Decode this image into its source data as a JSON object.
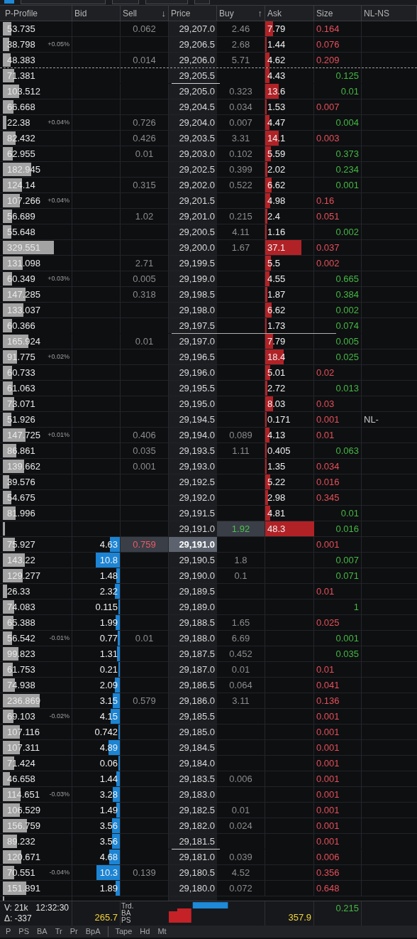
{
  "toolbar": {
    "fields": [
      {
        "kind": "checkbox",
        "checked": true
      },
      {
        "kind": "field"
      },
      {
        "kind": "field"
      },
      {
        "kind": "field"
      },
      {
        "kind": "field"
      }
    ]
  },
  "columns": [
    "P-Profile",
    "Bid",
    "Sell",
    "Price",
    "Buy",
    "Ask",
    "Size",
    "NL-NS"
  ],
  "sort": {
    "sell": "↓",
    "buy": "↑"
  },
  "rows": [
    {
      "profile": {
        "text": "53.735",
        "level": 0.12
      },
      "sell": "0.062",
      "price": "29,207.0",
      "buy": "2.46",
      "ask": {
        "text": "7.79",
        "level": 0.16
      },
      "lot": {
        "text": "0.164",
        "kind": "sell"
      }
    },
    {
      "profile": {
        "text": "38.798",
        "level": 0.09
      },
      "change": "+0.05%",
      "price": "29,206.5",
      "buy": "2.68",
      "ask": {
        "text": "1.44",
        "level": 0.03
      },
      "lot": {
        "text": "0.076",
        "kind": "sell"
      }
    },
    {
      "profile": {
        "text": "48.383",
        "level": 0.11
      },
      "sell": "0.014",
      "price": "29,206.0",
      "buy": "5.71",
      "ask": {
        "text": "4.62",
        "level": 0.09
      },
      "lot": {
        "text": "0.209",
        "kind": "sell"
      },
      "divider": {
        "kind": "dashed"
      }
    },
    {
      "profile": {
        "text": "71.381",
        "level": 0.16
      },
      "price": "29,205.5",
      "ask": {
        "text": "4.43",
        "level": 0.09
      },
      "lot": {
        "text": "0.125",
        "kind": "buy"
      },
      "divider": {
        "kind": "price"
      }
    },
    {
      "profile": {
        "text": "103.512",
        "level": 0.23
      },
      "price": "29,205.0",
      "buy": "0.323",
      "ask": {
        "text": "13.6",
        "level": 0.27
      },
      "lot": {
        "text": "0.01",
        "kind": "buy"
      }
    },
    {
      "profile": {
        "text": "66.668",
        "level": 0.15
      },
      "price": "29,204.5",
      "buy": "0.034",
      "ask": {
        "text": "1.53",
        "level": 0.03
      },
      "lot": {
        "text": "0.007",
        "kind": "sell"
      }
    },
    {
      "profile": {
        "text": "22.38",
        "level": 0.05
      },
      "change": "+0.04%",
      "sell": "0.726",
      "price": "29,204.0",
      "buy": "0.007",
      "ask": {
        "text": "4.47",
        "level": 0.09
      },
      "lot": {
        "text": "0.004",
        "kind": "buy"
      }
    },
    {
      "profile": {
        "text": "82.432",
        "level": 0.18
      },
      "sell": "0.426",
      "price": "29,203.5",
      "buy": "3.31",
      "ask": {
        "text": "14.1",
        "level": 0.28
      },
      "lot": {
        "text": "0.003",
        "kind": "sell"
      }
    },
    {
      "profile": {
        "text": "62.955",
        "level": 0.14
      },
      "sell": "0.01",
      "price": "29,203.0",
      "buy": "0.102",
      "ask": {
        "text": "5.59",
        "level": 0.11
      },
      "lot": {
        "text": "0.373",
        "kind": "buy"
      }
    },
    {
      "profile": {
        "text": "182.945",
        "level": 0.41
      },
      "price": "29,202.5",
      "buy": "0.399",
      "ask": {
        "text": "2.02",
        "level": 0.04
      },
      "lot": {
        "text": "0.234",
        "kind": "buy"
      }
    },
    {
      "profile": {
        "text": "124.14",
        "level": 0.28
      },
      "sell": "0.315",
      "price": "29,202.0",
      "buy": "0.522",
      "ask": {
        "text": "6.62",
        "level": 0.13
      },
      "lot": {
        "text": "0.001",
        "kind": "buy"
      }
    },
    {
      "profile": {
        "text": "107.266",
        "level": 0.24
      },
      "change": "+0.04%",
      "price": "29,201.5",
      "ask": {
        "text": "4.98",
        "level": 0.1
      },
      "lot": {
        "text": "0.16",
        "kind": "sell"
      }
    },
    {
      "profile": {
        "text": "56.689",
        "level": 0.13
      },
      "sell": "1.02",
      "price": "29,201.0",
      "buy": "0.215",
      "ask": {
        "text": "2.4",
        "level": 0.05
      },
      "lot": {
        "text": "0.051",
        "kind": "sell"
      }
    },
    {
      "profile": {
        "text": "55.648",
        "level": 0.12
      },
      "price": "29,200.5",
      "buy": "4.11",
      "ask": {
        "text": "1.16",
        "level": 0.02
      },
      "lot": {
        "text": "0.002",
        "kind": "buy"
      }
    },
    {
      "profile": {
        "text": "329.551",
        "level": 0.73
      },
      "price": "29,200.0",
      "buy": "1.67",
      "ask": {
        "text": "37.1",
        "level": 0.74
      },
      "lot": {
        "text": "0.037",
        "kind": "sell"
      }
    },
    {
      "profile": {
        "text": "131.098",
        "level": 0.29
      },
      "sell": "2.71",
      "price": "29,199.5",
      "ask": {
        "text": "5.5",
        "level": 0.11
      },
      "lot": {
        "text": "0.002",
        "kind": "sell"
      }
    },
    {
      "profile": {
        "text": "60.349",
        "level": 0.13
      },
      "change": "+0.03%",
      "sell": "0.005",
      "price": "29,199.0",
      "ask": {
        "text": "4.55",
        "level": 0.09
      },
      "lot": {
        "text": "0.665",
        "kind": "buy"
      }
    },
    {
      "profile": {
        "text": "147.285",
        "level": 0.33
      },
      "sell": "0.318",
      "price": "29,198.5",
      "ask": {
        "text": "1.87",
        "level": 0.04
      },
      "lot": {
        "text": "0.384",
        "kind": "buy"
      }
    },
    {
      "profile": {
        "text": "133.037",
        "level": 0.3
      },
      "price": "29,198.0",
      "ask": {
        "text": "6.62",
        "level": 0.13
      },
      "lot": {
        "text": "0.002",
        "kind": "buy"
      }
    },
    {
      "profile": {
        "text": "60.366",
        "level": 0.13
      },
      "price": "29,197.5",
      "ask": {
        "text": "1.73",
        "level": 0.03
      },
      "lot": {
        "text": "0.074",
        "kind": "buy"
      },
      "divider": {
        "kind": "wide"
      }
    },
    {
      "profile": {
        "text": "165.924",
        "level": 0.37
      },
      "sell": "0.01",
      "price": "29,197.0",
      "ask": {
        "text": "7.79",
        "level": 0.16
      },
      "lot": {
        "text": "0.005",
        "kind": "buy"
      }
    },
    {
      "profile": {
        "text": "91.775",
        "level": 0.2
      },
      "change": "+0.02%",
      "price": "29,196.5",
      "ask": {
        "text": "18.4",
        "level": 0.37
      },
      "lot": {
        "text": "0.025",
        "kind": "buy"
      }
    },
    {
      "profile": {
        "text": "60.733",
        "level": 0.13
      },
      "price": "29,196.0",
      "ask": {
        "text": "5.01",
        "level": 0.1
      },
      "lot": {
        "text": "0.02",
        "kind": "sell"
      }
    },
    {
      "profile": {
        "text": "61.063",
        "level": 0.14
      },
      "price": "29,195.5",
      "ask": {
        "text": "2.72",
        "level": 0.05
      },
      "lot": {
        "text": "0.013",
        "kind": "buy"
      }
    },
    {
      "profile": {
        "text": "73.071",
        "level": 0.16
      },
      "price": "29,195.0",
      "ask": {
        "text": "8.03",
        "level": 0.16
      },
      "lot": {
        "text": "0.03",
        "kind": "sell"
      }
    },
    {
      "profile": {
        "text": "51.926",
        "level": 0.12
      },
      "price": "29,194.5",
      "ask": {
        "text": "0.171",
        "level": 0.01
      },
      "lot": {
        "text": "0.001",
        "kind": "sell"
      },
      "nl_ns": "NL-"
    },
    {
      "profile": {
        "text": "147.725",
        "level": 0.33
      },
      "change": "+0.01%",
      "sell": "0.406",
      "price": "29,194.0",
      "buy": "0.089",
      "ask": {
        "text": "4.13",
        "level": 0.08
      },
      "lot": {
        "text": "0.01",
        "kind": "sell"
      }
    },
    {
      "profile": {
        "text": "86.861",
        "level": 0.19
      },
      "sell": "0.035",
      "price": "29,193.5",
      "buy": "1.11",
      "ask": {
        "text": "0.405",
        "level": 0.01
      },
      "lot": {
        "text": "0.063",
        "kind": "buy"
      }
    },
    {
      "profile": {
        "text": "139.662",
        "level": 0.31
      },
      "sell": "0.001",
      "price": "29,193.0",
      "ask": {
        "text": "1.35",
        "level": 0.03
      },
      "lot": {
        "text": "0.034",
        "kind": "sell"
      }
    },
    {
      "profile": {
        "text": "39.576",
        "level": 0.09
      },
      "price": "29,192.5",
      "ask": {
        "text": "5.22",
        "level": 0.1
      },
      "lot": {
        "text": "0.016",
        "kind": "sell"
      }
    },
    {
      "profile": {
        "text": "54.675",
        "level": 0.12
      },
      "price": "29,192.0",
      "ask": {
        "text": "2.98",
        "level": 0.06
      },
      "lot": {
        "text": "0.345",
        "kind": "sell"
      }
    },
    {
      "profile": {
        "text": "81.996",
        "level": 0.18
      },
      "price": "29,191.5",
      "ask": {
        "text": "4.81",
        "level": 0.1
      },
      "lot": {
        "text": "0.01",
        "kind": "buy"
      }
    },
    {
      "profile": {
        "level": 0.02
      },
      "price": "29,191.0",
      "buy": "1.92",
      "ask": {
        "text": "48.3",
        "level": 1
      },
      "lot": {
        "text": "0.016",
        "kind": "buy"
      },
      "highlight": {
        "kind": "buy"
      }
    },
    {
      "profile": {
        "text": "75.927",
        "level": 0.17
      },
      "bid": {
        "text": "4.63",
        "level": 0.21
      },
      "sell": "0.759",
      "price": "29,191.0",
      "lot": {
        "text": "0.001",
        "kind": "sell"
      },
      "highlight": {
        "kind": "trade"
      }
    },
    {
      "profile": {
        "text": "143.22",
        "level": 0.32
      },
      "bid": {
        "text": "10.8",
        "level": 0.5
      },
      "price": "29,190.5",
      "buy": "1.8",
      "lot": {
        "text": "0.007",
        "kind": "buy"
      }
    },
    {
      "profile": {
        "text": "129.277",
        "level": 0.29
      },
      "bid": {
        "text": "1.48",
        "level": 0.07
      },
      "price": "29,190.0",
      "buy": "0.1",
      "lot": {
        "text": "0.071",
        "kind": "buy"
      }
    },
    {
      "profile": {
        "text": "26.33",
        "level": 0.06
      },
      "bid": {
        "text": "2.32",
        "level": 0.11
      },
      "price": "29,189.5",
      "lot": {
        "text": "0.01",
        "kind": "sell"
      }
    },
    {
      "profile": {
        "text": "74.083",
        "level": 0.16
      },
      "bid": {
        "text": "0.115",
        "level": 0.01
      },
      "price": "29,189.0",
      "lot": {
        "text": "1",
        "kind": "buy"
      }
    },
    {
      "profile": {
        "text": "65.388",
        "level": 0.15
      },
      "bid": {
        "text": "1.99",
        "level": 0.09
      },
      "price": "29,188.5",
      "buy": "1.65",
      "lot": {
        "text": "0.025",
        "kind": "sell"
      }
    },
    {
      "profile": {
        "text": "56.542",
        "level": 0.13
      },
      "change": "-0.01%",
      "bid": {
        "text": "0.77",
        "level": 0.04
      },
      "sell": "0.01",
      "price": "29,188.0",
      "buy": "6.69",
      "lot": {
        "text": "0.001",
        "kind": "buy"
      }
    },
    {
      "profile": {
        "text": "99.823",
        "level": 0.22
      },
      "bid": {
        "text": "1.31",
        "level": 0.06
      },
      "price": "29,187.5",
      "buy": "0.452",
      "lot": {
        "text": "0.035",
        "kind": "buy"
      }
    },
    {
      "profile": {
        "text": "61.753",
        "level": 0.14
      },
      "bid": {
        "text": "0.21",
        "level": 0.01
      },
      "price": "29,187.0",
      "buy": "0.01",
      "lot": {
        "text": "0.01",
        "kind": "sell"
      }
    },
    {
      "profile": {
        "text": "74.938",
        "level": 0.17
      },
      "bid": {
        "text": "2.09",
        "level": 0.1
      },
      "price": "29,186.5",
      "buy": "0.064",
      "lot": {
        "text": "0.041",
        "kind": "sell"
      }
    },
    {
      "profile": {
        "text": "236.869",
        "level": 0.53
      },
      "bid": {
        "text": "3.15",
        "level": 0.15
      },
      "sell": "0.579",
      "price": "29,186.0",
      "buy": "3.11",
      "lot": {
        "text": "0.136",
        "kind": "sell"
      }
    },
    {
      "profile": {
        "text": "69.103",
        "level": 0.15
      },
      "change": "-0.02%",
      "bid": {
        "text": "4.15",
        "level": 0.19
      },
      "price": "29,185.5",
      "lot": {
        "text": "0.001",
        "kind": "sell"
      }
    },
    {
      "profile": {
        "text": "107.116",
        "level": 0.24
      },
      "bid": {
        "text": "0.742",
        "level": 0.03
      },
      "price": "29,185.0",
      "lot": {
        "text": "0.001",
        "kind": "sell"
      }
    },
    {
      "profile": {
        "text": "107.311",
        "level": 0.24
      },
      "bid": {
        "text": "4.89",
        "level": 0.23
      },
      "price": "29,184.5",
      "lot": {
        "text": "0.001",
        "kind": "sell"
      }
    },
    {
      "profile": {
        "text": "71.424",
        "level": 0.16
      },
      "bid": {
        "text": "0.06",
        "level": 0.01
      },
      "price": "29,184.0",
      "lot": {
        "text": "0.001",
        "kind": "sell"
      }
    },
    {
      "profile": {
        "text": "46.658",
        "level": 0.1
      },
      "bid": {
        "text": "1.44",
        "level": 0.07
      },
      "price": "29,183.5",
      "buy": "0.006",
      "lot": {
        "text": "0.001",
        "kind": "sell"
      }
    },
    {
      "profile": {
        "text": "114.651",
        "level": 0.25
      },
      "change": "-0.03%",
      "bid": {
        "text": "3.28",
        "level": 0.15
      },
      "price": "29,183.0",
      "lot": {
        "text": "0.001",
        "kind": "sell"
      }
    },
    {
      "profile": {
        "text": "106.529",
        "level": 0.24
      },
      "bid": {
        "text": "1.49",
        "level": 0.07
      },
      "price": "29,182.5",
      "buy": "0.01",
      "lot": {
        "text": "0.001",
        "kind": "sell"
      }
    },
    {
      "profile": {
        "text": "156.759",
        "level": 0.35
      },
      "bid": {
        "text": "3.56",
        "level": 0.16
      },
      "price": "29,182.0",
      "buy": "0.024",
      "lot": {
        "text": "0.001",
        "kind": "sell"
      }
    },
    {
      "profile": {
        "text": "89.232",
        "level": 0.2
      },
      "bid": {
        "text": "3.56",
        "level": 0.16
      },
      "price": "29,181.5",
      "lot": {
        "text": "0.001",
        "kind": "sell"
      },
      "divider": {
        "kind": "price"
      }
    },
    {
      "profile": {
        "text": "120.671",
        "level": 0.27
      },
      "bid": {
        "text": "4.68",
        "level": 0.22
      },
      "price": "29,181.0",
      "buy": "0.039",
      "lot": {
        "text": "0.006",
        "kind": "sell"
      }
    },
    {
      "profile": {
        "text": "70.551",
        "level": 0.16
      },
      "change": "-0.04%",
      "bid": {
        "text": "10.3",
        "level": 0.48
      },
      "sell": "0.139",
      "price": "29,180.5",
      "buy": "4.52",
      "lot": {
        "text": "0.356",
        "kind": "sell"
      }
    },
    {
      "profile": {
        "text": "151.891",
        "level": 0.34
      },
      "bid": {
        "text": "1.89",
        "level": 0.09
      },
      "price": "29,180.0",
      "buy": "0.072",
      "lot": {
        "text": "0.648",
        "kind": "sell"
      }
    }
  ],
  "footer": {
    "volume": "V: 21k",
    "time": "12:32:30",
    "delta": "Δ: -337",
    "bid_total": "265.7",
    "legend": [
      "Trd.",
      "BA",
      "PS"
    ],
    "ask_total": "357.9",
    "size_total": "0.215"
  },
  "tab_groups": [
    [
      {
        "label": "P",
        "selected": false
      },
      {
        "label": "PS",
        "selected": false
      },
      {
        "label": "BA",
        "selected": false
      },
      {
        "label": "Tr",
        "selected": false
      },
      {
        "label": "Pr",
        "selected": false
      },
      {
        "label": "BpA",
        "selected": false
      }
    ],
    [
      {
        "label": "Tape",
        "selected": false
      },
      {
        "label": "Hd",
        "selected": false
      },
      {
        "label": "Mt",
        "selected": false
      }
    ]
  ]
}
